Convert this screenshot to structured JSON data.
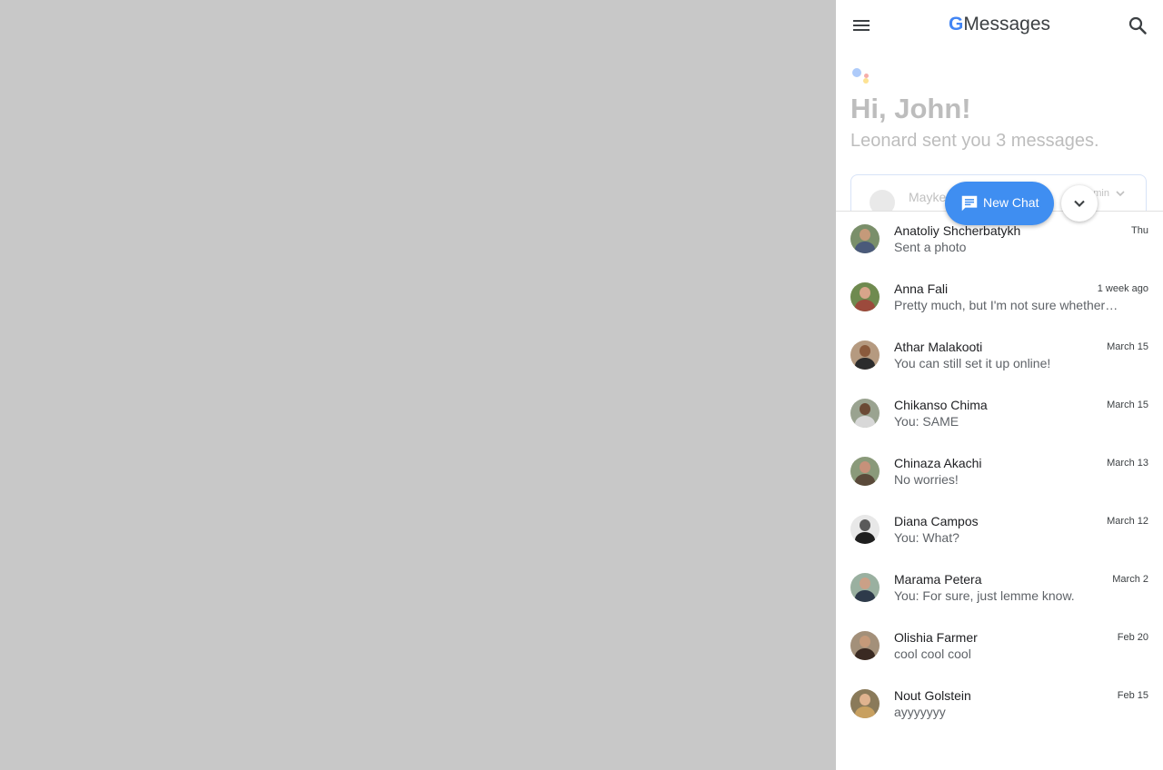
{
  "header": {
    "brand_g": "G",
    "brand_name": "Messages",
    "menu_icon": "hamburger-menu-icon",
    "search_icon": "search-icon"
  },
  "assistant": {
    "greeting": "Hi, John!",
    "summary": "Leonard sent you 3 messages.",
    "preview": {
      "name": "Mayke",
      "time": "min"
    }
  },
  "fab": {
    "label": "New Chat",
    "icon": "chat-bubble-icon"
  },
  "collapse": {
    "icon": "chevron-down-icon"
  },
  "conversations": [
    {
      "name": "Anatoliy Shcherbatykh",
      "snippet": "Sent a photo",
      "time": "Thu",
      "bg": "#7a8f6a",
      "head": "#c59a7a",
      "shirt": "#4a5a7a"
    },
    {
      "name": "Anna Fali",
      "snippet": "Pretty much, but I'm not sure whether…",
      "time": "1 week ago",
      "bg": "#6f8a4f",
      "head": "#d8a58a",
      "shirt": "#9c4a3c"
    },
    {
      "name": "Athar Malakooti",
      "snippet": "You can still set it up online!",
      "time": "March 15",
      "bg": "#b59a80",
      "head": "#8a5a3c",
      "shirt": "#2c2c2c"
    },
    {
      "name": "Chikanso Chima",
      "snippet": "You: SAME",
      "time": "March 15",
      "bg": "#9aa390",
      "head": "#6b4a35",
      "shirt": "#d8d8d8"
    },
    {
      "name": "Chinaza Akachi",
      "snippet": "No worries!",
      "time": "March 13",
      "bg": "#8a9a7a",
      "head": "#c7917a",
      "shirt": "#5a4a3a"
    },
    {
      "name": "Diana Campos",
      "snippet": "You: What?",
      "time": "March 12",
      "bg": "#e8e8e8",
      "head": "#5a5a5a",
      "shirt": "#1f1f1f"
    },
    {
      "name": "Marama Petera",
      "snippet": "You: For sure, just lemme know.",
      "time": "March 2",
      "bg": "#9ab0a0",
      "head": "#caa087",
      "shirt": "#2e3a4a"
    },
    {
      "name": "Olishia Farmer",
      "snippet": "cool cool cool",
      "time": "Feb 20",
      "bg": "#a3907a",
      "head": "#c59a7a",
      "shirt": "#3a2a22"
    },
    {
      "name": "Nout Golstein",
      "snippet": "ayyyyyyy",
      "time": "Feb 15",
      "bg": "#8a7a5a",
      "head": "#e0b38f",
      "shirt": "#c8a060"
    }
  ]
}
